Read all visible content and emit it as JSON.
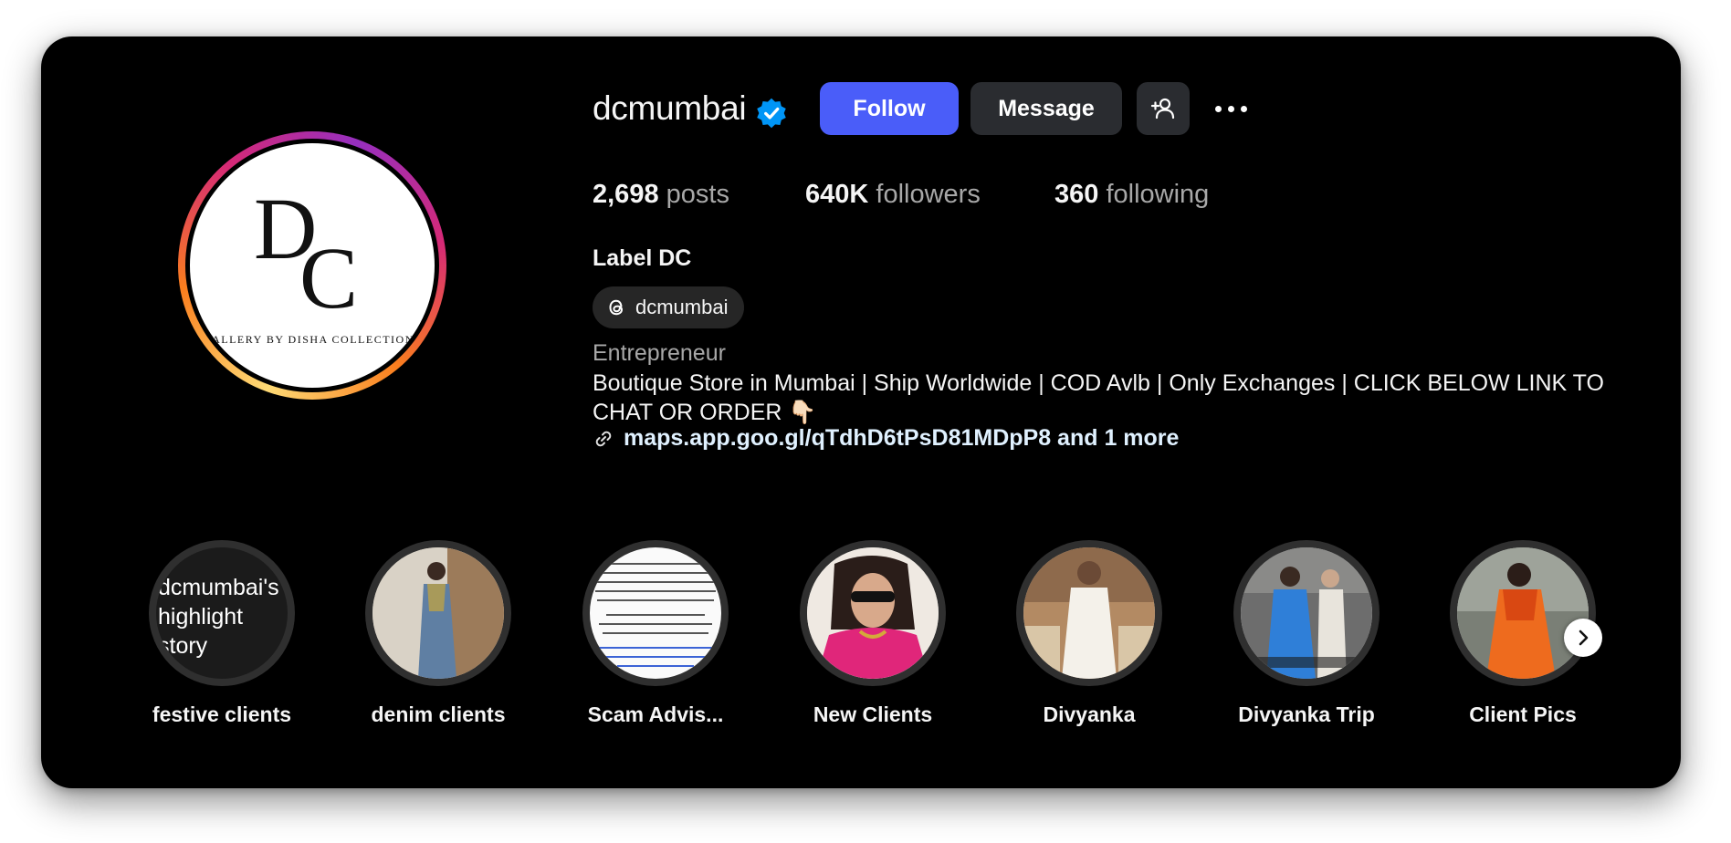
{
  "profile": {
    "username": "dcmumbai",
    "verified_icon": "verified-badge-icon",
    "avatar_logo_text": "DC",
    "avatar_tagline": "GALLERY BY DISHA COLLECTIONS"
  },
  "actions": {
    "follow_label": "Follow",
    "message_label": "Message",
    "add_user_icon": "person-add-icon",
    "more_icon": "more-options-icon"
  },
  "stats": {
    "posts_count": "2,698",
    "posts_label": "posts",
    "followers_count": "640K",
    "followers_label": "followers",
    "following_count": "360",
    "following_label": "following"
  },
  "bio": {
    "display_name": "Label DC",
    "threads_handle": "dcmumbai",
    "category": "Entrepreneur",
    "text": "Boutique Store in Mumbai | Ship Worldwide | COD Avlb | Only Exchanges | CLICK BELOW LINK TO CHAT OR ORDER 👇🏻",
    "link": "maps.app.goo.gl/qTdhD6tPsD81MDpP8 and 1 more"
  },
  "highlights": [
    {
      "label": "festive clients",
      "cover_text": "dcmumbai's highlight story"
    },
    {
      "label": "denim clients"
    },
    {
      "label": "Scam Advis..."
    },
    {
      "label": "New Clients"
    },
    {
      "label": "Divyanka"
    },
    {
      "label": "Divyanka Trip"
    },
    {
      "label": "Client Pics"
    }
  ],
  "colors": {
    "background": "#000000",
    "follow_button": "#4a5df9",
    "secondary_button": "#2a2c30",
    "verified": "#0095f6",
    "muted_text": "#a8a8a8"
  }
}
